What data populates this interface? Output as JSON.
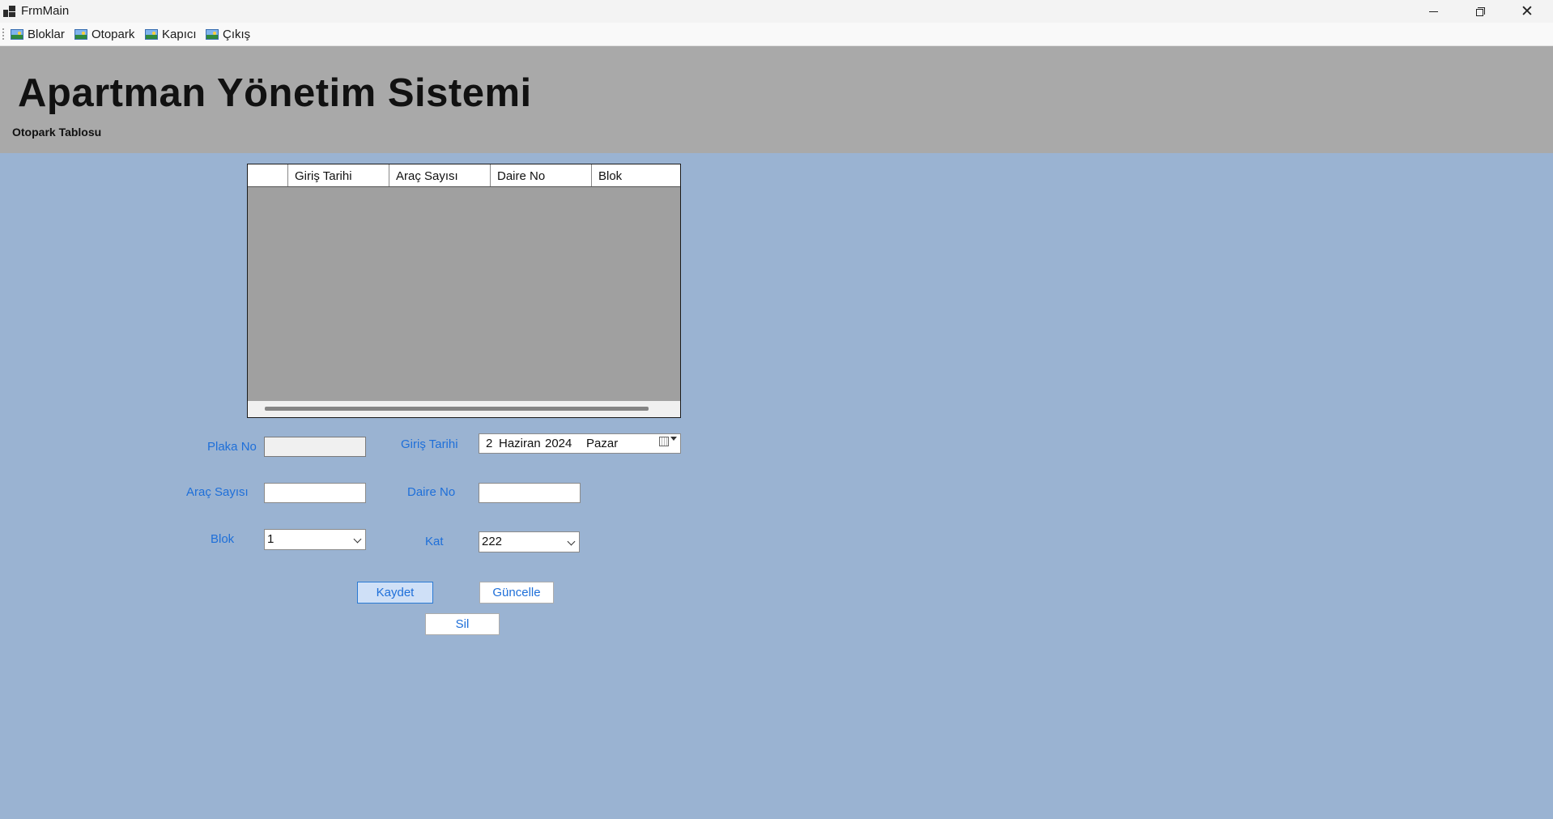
{
  "window": {
    "title": "FrmMain"
  },
  "menu": {
    "items": [
      {
        "label": "Bloklar",
        "icon": "image-icon"
      },
      {
        "label": "Otopark",
        "icon": "image-icon"
      },
      {
        "label": "Kapıcı",
        "icon": "image-icon"
      },
      {
        "label": "Çıkış",
        "icon": "image-icon"
      }
    ]
  },
  "header": {
    "title": "Apartman Yönetim Sistemi",
    "subtitle": "Otopark Tablosu"
  },
  "grid": {
    "columns": [
      "Giriş Tarihi",
      "Araç Sayısı",
      "Daire No",
      "Blok"
    ],
    "rows": []
  },
  "form": {
    "plaka_label": "Plaka No",
    "plaka_value": "",
    "arac_label": "Araç Sayısı",
    "arac_value": "",
    "blok_label": "Blok",
    "blok_value": "1",
    "giris_label": "Giriş Tarihi",
    "date_day": "2",
    "date_month": "Haziran",
    "date_year": "2024",
    "date_weekday": "Pazar",
    "daire_label": "Daire No",
    "daire_value": "",
    "kat_label": "Kat",
    "kat_value": "222"
  },
  "buttons": {
    "save": "Kaydet",
    "update": "Güncelle",
    "delete": "Sil"
  },
  "colors": {
    "background": "#9ab3d2",
    "header": "#a9a9a9",
    "label": "#1e6fd9"
  }
}
